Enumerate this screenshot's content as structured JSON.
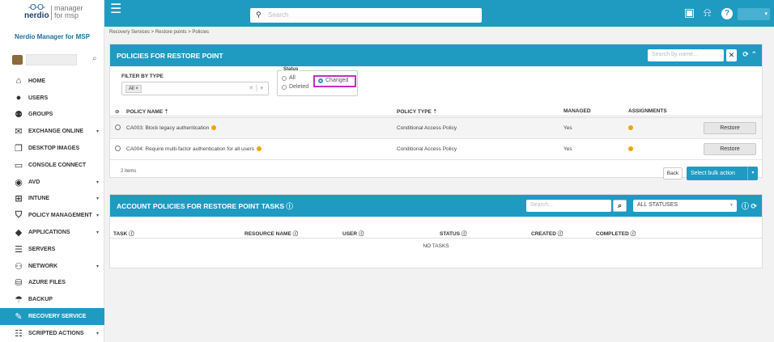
{
  "logo": {
    "brand": "nerdio",
    "product_line1": "manager",
    "product_line2": "for msp"
  },
  "sidebar": {
    "subtitle": "Nerdio Manager for MSP",
    "items": [
      {
        "label": "HOME",
        "icon": "home-icon"
      },
      {
        "label": "USERS",
        "icon": "user-icon"
      },
      {
        "label": "GROUPS",
        "icon": "groups-icon"
      },
      {
        "label": "EXCHANGE ONLINE",
        "icon": "mail-icon",
        "caret": "▾"
      },
      {
        "label": "DESKTOP IMAGES",
        "icon": "desktop-images-icon"
      },
      {
        "label": "CONSOLE CONNECT",
        "icon": "monitor-icon"
      },
      {
        "label": "AVD",
        "icon": "avd-icon",
        "caret": "▾"
      },
      {
        "label": "INTUNE",
        "icon": "intune-icon",
        "caret": "▾"
      },
      {
        "label": "POLICY MANAGEMENT",
        "icon": "shield-icon",
        "caret": "▾"
      },
      {
        "label": "APPLICATIONS",
        "icon": "applications-icon",
        "caret": "▾"
      },
      {
        "label": "SERVERS",
        "icon": "servers-icon"
      },
      {
        "label": "NETWORK",
        "icon": "network-icon",
        "caret": "▾"
      },
      {
        "label": "AZURE FILES",
        "icon": "database-icon"
      },
      {
        "label": "BACKUP",
        "icon": "umbrella-icon"
      },
      {
        "label": "RECOVERY SERVICE",
        "icon": "wrench-icon",
        "active": true
      },
      {
        "label": "SCRIPTED ACTIONS",
        "icon": "list-icon",
        "caret": "▾"
      }
    ]
  },
  "topbar": {
    "search_placeholder": "Search"
  },
  "breadcrumb": "Recovery Services > Restore points > Policies",
  "policies_panel": {
    "title": "POLICIES FOR RESTORE POINT",
    "search_placeholder": "Search by name...",
    "filter_label": "FILTER BY TYPE",
    "filter_chip": "All ×",
    "status_legend": "Status",
    "status_options": [
      "All",
      "Changed",
      "Deleted"
    ],
    "status_selected": "Changed",
    "columns": [
      "POLICY NAME ⇡",
      "POLICY TYPE ⇡",
      "MANAGED",
      "ASSIGNMENTS"
    ],
    "rows": [
      {
        "name": "CA003: Block legacy authentication",
        "type": "Conditional Access Policy",
        "managed": "Yes",
        "action": "Restore"
      },
      {
        "name": "CA004: Require multi-factor authentication for all users",
        "type": "Conditional Access Policy",
        "managed": "Yes",
        "action": "Restore"
      }
    ],
    "items_count": "2 items",
    "back_label": "Back",
    "bulk_label": "Select bulk action"
  },
  "tasks_panel": {
    "title": "ACCOUNT POLICIES FOR RESTORE POINT TASKS ⓘ",
    "search_placeholder": "Search...",
    "status_filter": "ALL STATUSES",
    "columns": [
      "TASK ⓘ",
      "RESOURCE NAME ⓘ",
      "USER ⓘ",
      "STATUS ⓘ",
      "CREATED ⓘ",
      "COMPLETED ⓘ"
    ],
    "empty_text": "NO TASKS"
  },
  "colors": {
    "accent": "#1f9bc2",
    "highlight": "#c52fc2",
    "warning": "#f0a500"
  }
}
